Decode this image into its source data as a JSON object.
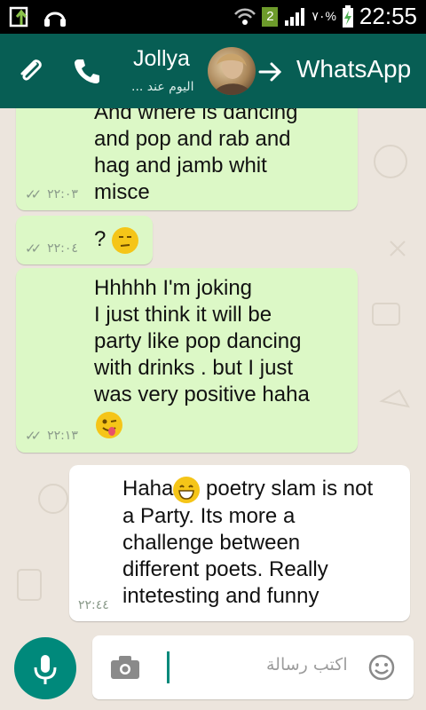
{
  "status_bar": {
    "time": "22:55",
    "battery": "٧٠%",
    "sim_badge": "2"
  },
  "header": {
    "contact_name": "Jollya",
    "contact_status": "اليوم عند ...",
    "app_title": "WhatsApp"
  },
  "messages": [
    {
      "text": "And where is dancing\nand pop and rab and\nhag and jamb whit\nmisce",
      "time": "٢٢:٠٣"
    },
    {
      "text": "? ",
      "emoji": "unamused-emoji",
      "time": "٢٢:٠٤"
    },
    {
      "text": "Hhhhh I'm joking\nI just think it will be\nparty like pop dancing\nwith drinks . but I just\nwas very positive haha",
      "emoji": "winking-tongue-emoji",
      "time": "٢٢:١٣"
    },
    {
      "text_before_emoji": "Haha",
      "emoji": "grinning-emoji",
      "text_after_emoji": " poetry slam is not\na Party. Its more a\nchallenge between\ndifferent poets. Really\nintetesting and funny",
      "time": "٢٢:٤٤"
    }
  ],
  "composer": {
    "placeholder": "اكتب رسالة"
  },
  "colors": {
    "header": "#075e54",
    "outgoing_bubble": "#dcf8c6",
    "incoming_bubble": "#ffffff",
    "accent": "#00897b"
  }
}
